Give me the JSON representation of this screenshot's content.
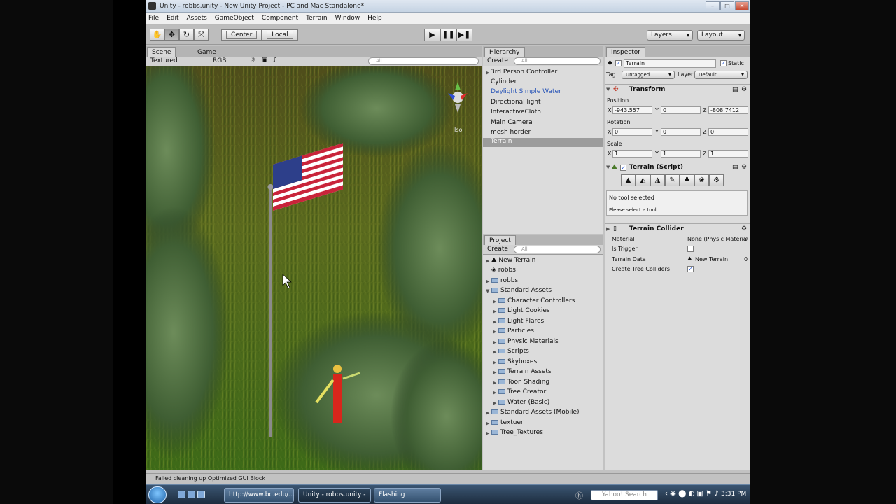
{
  "window": {
    "title": "Unity - robbs.unity - New Unity Project - PC and Mac Standalone*"
  },
  "menu": [
    "File",
    "Edit",
    "Assets",
    "GameObject",
    "Component",
    "Terrain",
    "Window",
    "Help"
  ],
  "toolbar": {
    "center_label": "Center",
    "local_label": "Local",
    "layers_label": "Layers",
    "layout_label": "Layout"
  },
  "scene": {
    "tab_scene": "Scene",
    "tab_game": "Game",
    "render_mode": "Textured",
    "color_mode": "RGB",
    "search_placeholder": "All",
    "iso_label": "Iso"
  },
  "hierarchy": {
    "title": "Hierarchy",
    "create_label": "Create",
    "search_placeholder": "All",
    "items": [
      "3rd Person Controller",
      "Cylinder",
      "Daylight Simple Water",
      "Directional light",
      "InteractiveCloth",
      "Main Camera",
      "mesh horder",
      "Terrain"
    ],
    "selected": "Terrain"
  },
  "project": {
    "title": "Project",
    "create_label": "Create",
    "search_placeholder": "All",
    "items": [
      "New Terrain",
      "robbs",
      "robbs",
      "Standard Assets",
      "Character Controllers",
      "Light Cookies",
      "Light Flares",
      "Particles",
      "Physic Materials",
      "Scripts",
      "Skyboxes",
      "Terrain Assets",
      "Toon Shading",
      "Tree Creator",
      "Water (Basic)",
      "Standard Assets (Mobile)",
      "textuer",
      "Tree_Textures"
    ]
  },
  "inspector": {
    "title": "Inspector",
    "object_name": "Terrain",
    "static_label": "Static",
    "tag_label": "Tag",
    "tag_value": "Untagged",
    "layer_label": "Layer",
    "layer_value": "Default",
    "transform_title": "Transform",
    "position_label": "Position",
    "pos_x": "-943.557",
    "pos_y": "0",
    "pos_z": "-808.7412",
    "rotation_label": "Rotation",
    "rot_x": "0",
    "rot_y": "0",
    "rot_z": "0",
    "scale_label": "Scale",
    "scale_x": "1",
    "scale_y": "1",
    "scale_z": "1",
    "axis_x": "X",
    "axis_y": "Y",
    "axis_z": "Z",
    "terrain_script_title": "Terrain (Script)",
    "no_tool": "No tool selected",
    "select_tool": "Please select a tool",
    "collider_title": "Terrain Collider",
    "material_label": "Material",
    "material_value": "None (Physic Materiæ",
    "trigger_label": "Is Trigger",
    "terrain_data_label": "Terrain Data",
    "terrain_data_value": "New Terrain",
    "tree_colliders_label": "Create Tree Colliders",
    "zero": "0"
  },
  "status": {
    "message": "Failed cleaning up Optimized GUI Block"
  },
  "taskbar": {
    "task1": "http://www.bc.edu/...",
    "task2": "Unity - robbs.unity - ...",
    "task3": "Flashing",
    "search": "Yahoo! Search",
    "time": "3:31 PM"
  }
}
